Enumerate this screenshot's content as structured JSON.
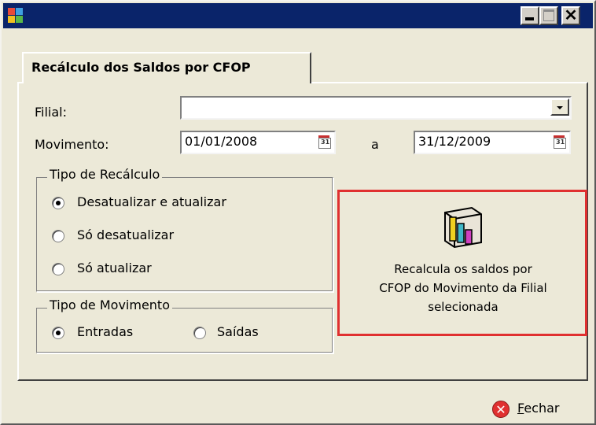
{
  "window": {
    "title": "",
    "controls": {
      "minimize": "minimize",
      "maximize": "maximize",
      "close": "close"
    }
  },
  "tab": {
    "label": "Recálculo dos Saldos por CFOP"
  },
  "form": {
    "filial_label": "Filial:",
    "filial_value": "",
    "movimento_label": "Movimento:",
    "date_from": "01/01/2008",
    "date_separator": "a",
    "date_to": "31/12/2009",
    "calendar_glyph": "31"
  },
  "tipo_recalculo": {
    "title": "Tipo de Recálculo",
    "options": [
      "Desatualizar e atualizar",
      "Só desatualizar",
      "Só atualizar"
    ],
    "selected": "Desatualizar e atualizar"
  },
  "tipo_movimento": {
    "title": "Tipo de Movimento",
    "options": [
      "Entradas",
      "Saídas"
    ],
    "selected": "Entradas"
  },
  "info_panel": {
    "line1": "Recalcula os saldos por",
    "line2": "CFOP do Movimento da Filial",
    "line3": "selecionada",
    "icon": "chart-icon",
    "highlight_color": "#e03030"
  },
  "footer": {
    "close_label_first": "F",
    "close_label_rest": "echar",
    "close_icon": "x-circle-icon"
  },
  "colors": {
    "titlebar": "#0a246a",
    "window_bg": "#ece9d8"
  }
}
